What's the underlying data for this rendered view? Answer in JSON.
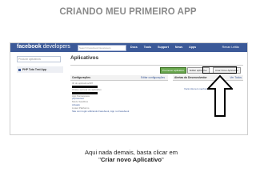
{
  "slide": {
    "title": "CRIANDO MEU PRIMEIRO APP",
    "caption_line1": "Aqui nada demais, basta clicar em",
    "caption_line2_open": "\"",
    "caption_line2_bold": "Criar novo Aplicativo",
    "caption_line2_close": "\""
  },
  "fb": {
    "logo": "facebook",
    "logo_suffix": "developers",
    "search_placeholder": "Search Facebook Developers",
    "nav": [
      "Docs",
      "Tools",
      "Support",
      "News",
      "Apps"
    ],
    "user": "Renan Leitão"
  },
  "sidebar": {
    "search_placeholder": "Procurar aplicativos",
    "items": [
      {
        "label": "PHP Tuto Test App"
      }
    ]
  },
  "main": {
    "title": "Aplicativos",
    "buttons": {
      "promote": "Promover aplicativo",
      "edit": "Editar aplicativo",
      "create": "Criar Novo Aplicativo"
    },
    "left_pane": {
      "header": "Configurações",
      "header_link": "Editar configurações",
      "fields": [
        {
          "label": "ID do aplicativo/API",
          "value": ""
        },
        {
          "label": "Chave secreta do aplicativo",
          "value": ""
        },
        {
          "label": "App Namespace",
          "value": "phptutotest"
        },
        {
          "label": "Modo Sandbox",
          "value": "Ativado"
        },
        {
          "label": "Listed Platforms",
          "value": "Site com login utilizando Facebook, App no Facebook"
        }
      ]
    },
    "right_pane": {
      "header": "Alertas do Desenvolvedor",
      "header_extra": "Ver Todos",
      "note": "Você não tem nenhum alerta."
    }
  }
}
